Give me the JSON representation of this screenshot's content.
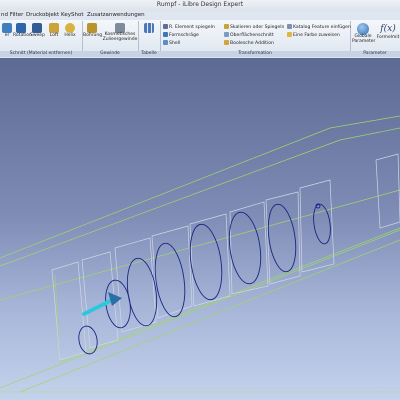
{
  "window": {
    "title": "Rumpf - iLibre Design Expert"
  },
  "menu": {
    "items": [
      "nd Filter",
      "Druckobjekt",
      "KeyShot",
      "Zusatzanwendungen"
    ]
  },
  "ribbon": {
    "group_schnitt": {
      "label": "Schnitt (Material entfernen)",
      "buttons": [
        "er",
        "Rotation",
        "Sweep",
        "Loft",
        "Helix"
      ]
    },
    "group_gewinde": {
      "label": "Gewinde",
      "buttons": [
        "Bohrung",
        "Kosmetisches Zulieergewinde"
      ]
    },
    "group_tabelle": {
      "label": "Tabelle"
    },
    "group_transformation": {
      "label": "Transformation",
      "left_items": [
        "R. Element spiegeln",
        "Formschräge",
        "Shell"
      ],
      "middle_items": [
        "Skalieren oder Spiegeln",
        "Oberflächenschnitt",
        "Boolesche Addition"
      ],
      "right_items": [
        "Katalog Feature einfügen",
        "Eine Farbe zuweisen"
      ]
    },
    "group_parameter": {
      "label": "Parameter",
      "buttons": [
        "Globale Parameter",
        "Formelmit"
      ],
      "fx_glyph": "f(x)"
    }
  },
  "colors": {
    "accent_blue": "#2e6fb3",
    "edge_green": "#9fd86a",
    "hole_outline": "#1a2580",
    "arrow_cyan": "#2ec8dc"
  },
  "icons": {
    "ribbon_tabelle": "grid-icon",
    "arrow": "direction-arrow"
  }
}
